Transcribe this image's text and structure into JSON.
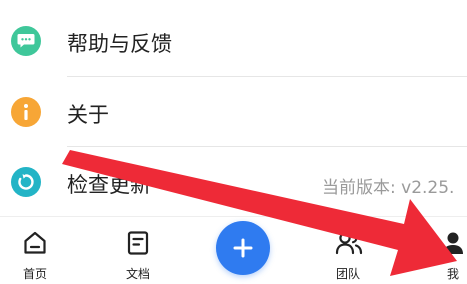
{
  "menu": {
    "items": [
      {
        "label": "帮助与反馈",
        "icon": "chat-bubble-icon",
        "color": "#3fc79a"
      },
      {
        "label": "关于",
        "icon": "info-icon",
        "color": "#f7a636"
      },
      {
        "label": "检查更新",
        "icon": "refresh-icon",
        "color": "#23b4c6"
      }
    ],
    "version_text": "当前版本: v2.25."
  },
  "tabbar": {
    "tabs": [
      {
        "label": "首页",
        "icon": "home-icon"
      },
      {
        "label": "文档",
        "icon": "document-icon"
      },
      {
        "label": "团队",
        "icon": "team-icon"
      },
      {
        "label": "我",
        "icon": "person-icon"
      }
    ],
    "add_icon": "plus-icon",
    "accent": "#2f7bf0"
  },
  "annotation": {
    "arrow_color": "#ee2a37"
  }
}
